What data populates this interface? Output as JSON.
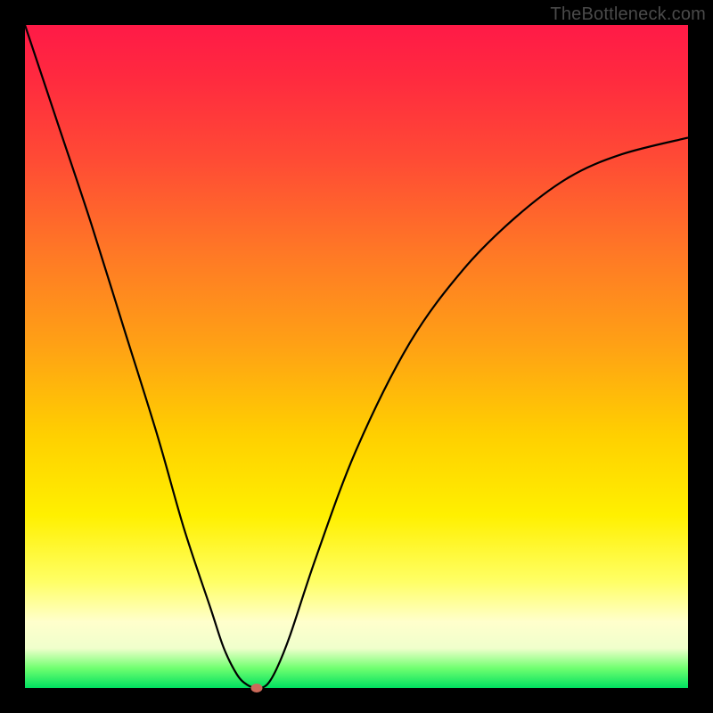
{
  "watermark": "TheBottleneck.com",
  "chart_data": {
    "type": "line",
    "title": "",
    "xlabel": "",
    "ylabel": "",
    "xlim": [
      0,
      100
    ],
    "ylim": [
      0,
      100
    ],
    "series": [
      {
        "name": "bottleneck-curve",
        "x": [
          0,
          5,
          10,
          15,
          20,
          24,
          28,
          30,
          32,
          33.5,
          35,
          36.5,
          38,
          40,
          44,
          50,
          58,
          66,
          74,
          82,
          90,
          100
        ],
        "values": [
          100,
          85,
          70,
          54,
          38,
          24,
          12,
          6,
          2,
          0.5,
          0,
          0.5,
          3,
          8,
          20,
          36,
          52,
          63,
          71,
          77,
          80.5,
          83
        ]
      }
    ],
    "marker": {
      "x": 35,
      "y": 0,
      "color": "#cc6a5a"
    },
    "background_gradient": {
      "top": "#ff1a47",
      "mid": "#ffd000",
      "bottom": "#00e060"
    }
  }
}
